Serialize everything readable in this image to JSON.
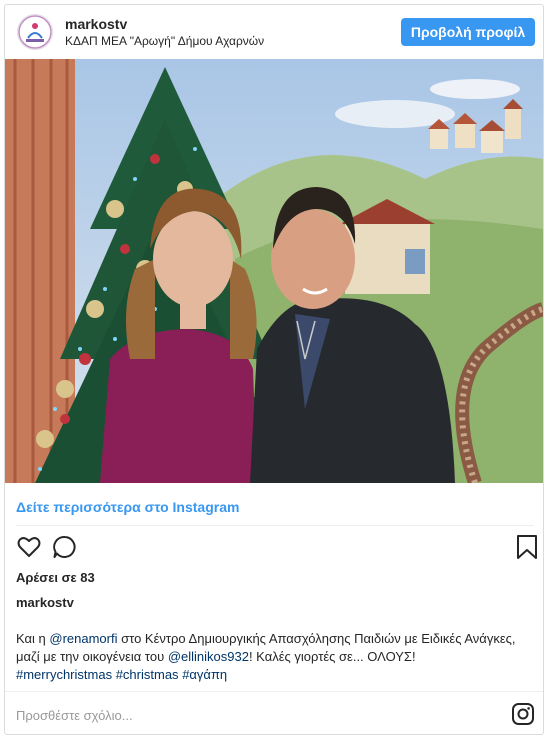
{
  "post": {
    "username": "markostv",
    "location": "ΚΔΑΠ ΜΕΑ \"Αρωγή\" Δήμου Αχαρνών",
    "profile_button": "Προβολή προφίλ",
    "more_link": "Δείτε περισσότερα στο Instagram",
    "likes": "Αρέσει σε 83",
    "caption_user": "markostv",
    "caption": {
      "p1": "Και η ",
      "mention1": "@renamorfi",
      "p2": " στο Κέντρο Δημιουργικής Απασχόλησης Παιδιών με Ειδικές Ανάγκες, μαζί με την οικογένεια του ",
      "mention2": "@ellinikos932",
      "p3": "! Καλές γιορτές σε... ΟΛΟΥΣ!",
      "tag1": "#merrychristmas",
      "tag2": "#christmas",
      "tag3": "#αγάπη"
    },
    "comment_placeholder": "Προσθέστε σχόλιο..."
  },
  "icons": {
    "like": "heart-icon",
    "comment": "comment-bubble-icon",
    "save": "bookmark-icon",
    "brand": "instagram-icon"
  },
  "colors": {
    "accent": "#3897f0",
    "mention": "#003569",
    "text": "#262626",
    "placeholder": "#999999"
  }
}
